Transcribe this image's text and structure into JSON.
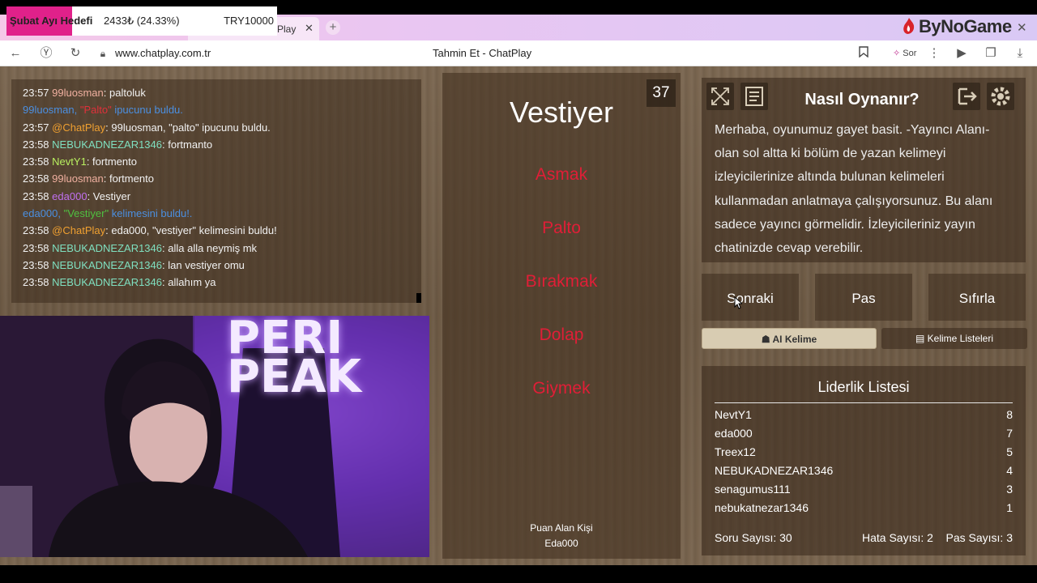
{
  "overlay": {
    "goal_label": "Şubat Ayı Hedefi",
    "goal_value": "2433₺ (24.33%)",
    "goal_target": "TRY10000",
    "goal_progress": 0.2433,
    "sponsor": "ByNoGame"
  },
  "browser": {
    "tab_title": "Play",
    "url": "www.chatplay.com.tr",
    "page_title": "Tahmin Et - ChatPlay",
    "sor_label": "Sor"
  },
  "chat": [
    {
      "time": "23:57",
      "user": "99luosman",
      "user_color": "#f0b0a0",
      "msg": "paltoluk",
      "sys": false
    },
    {
      "sys": true,
      "text_a": "99luosman, ",
      "hl": "\"Palto\"",
      "hl_color": "#e0303a",
      "text_b": " ipucunu buldu."
    },
    {
      "time": "23:57",
      "user": "@ChatPlay",
      "user_color": "#f0a030",
      "msg": "99luosman, \"palto\" ipucunu buldu.",
      "sys": false
    },
    {
      "time": "23:58",
      "user": "NEBUKADNEZAR1346",
      "user_color": "#7fe0c0",
      "msg": "fortmanto",
      "sys": false
    },
    {
      "time": "23:58",
      "user": "NevtY1",
      "user_color": "#b8f060",
      "msg": "fortmento",
      "sys": false
    },
    {
      "time": "23:58",
      "user": "99luosman",
      "user_color": "#f0b0a0",
      "msg": "fortmento",
      "sys": false
    },
    {
      "time": "23:58",
      "user": "eda000",
      "user_color": "#c070f0",
      "msg": "Vestiyer",
      "sys": false
    },
    {
      "sys": true,
      "text_a": "eda000, ",
      "hl": "\"Vestiyer\"",
      "hl_color": "#4fc040",
      "text_b": " kelimesini buldu!."
    },
    {
      "time": "23:58",
      "user": "@ChatPlay",
      "user_color": "#f0a030",
      "msg": "eda000, \"vestiyer\" kelimesini buldu!",
      "sys": false
    },
    {
      "time": "23:58",
      "user": "NEBUKADNEZAR1346",
      "user_color": "#7fe0c0",
      "msg": "alla alla neymiş mk",
      "sys": false
    },
    {
      "time": "23:58",
      "user": "NEBUKADNEZAR1346",
      "user_color": "#7fe0c0",
      "msg": "lan vestiyer omu",
      "sys": false
    },
    {
      "time": "23:58",
      "user": "NEBUKADNEZAR1346",
      "user_color": "#7fe0c0",
      "msg": "allahım ya",
      "sys": false
    }
  ],
  "webcam": {
    "sign": "PERI\nPEAK"
  },
  "game": {
    "counter": "37",
    "word": "Vestiyer",
    "taboo_words": [
      "Asmak",
      "Palto",
      "Bırakmak",
      "Dolap",
      "Giymek"
    ],
    "scorer_label": "Puan Alan Kişi",
    "scorer_name": "Eda000"
  },
  "help": {
    "title": "Nasıl Oynanır?",
    "text": "Merhaba, oyunumuz gayet basit. -Yayıncı Alanı- olan sol altta ki bölüm de yazan kelimeyi izleyicilerinize altında bulunan kelimeleri kullanmadan anlatmaya çalışıyorsunuz. Bu alanı sadece yayıncı görmelidir. İzleyicileriniz yayın chatinizde cevap verebilir."
  },
  "buttons": {
    "next": "Sonraki",
    "pass": "Pas",
    "reset": "Sıfırla",
    "ai_word": "AI Kelime",
    "word_lists": "Kelime Listeleri"
  },
  "leaderboard": {
    "title": "Liderlik Listesi",
    "rows": [
      {
        "name": "NevtY1",
        "score": "8"
      },
      {
        "name": "eda000",
        "score": "7"
      },
      {
        "name": "Treex12",
        "score": "5"
      },
      {
        "name": "NEBUKADNEZAR1346",
        "score": "4"
      },
      {
        "name": "senagumus111",
        "score": "3"
      },
      {
        "name": "nebukatnezar1346",
        "score": "1"
      }
    ],
    "questions": "Soru Sayısı: 30",
    "errors": "Hata Sayısı: 2",
    "passes": "Pas Sayısı: 3"
  }
}
